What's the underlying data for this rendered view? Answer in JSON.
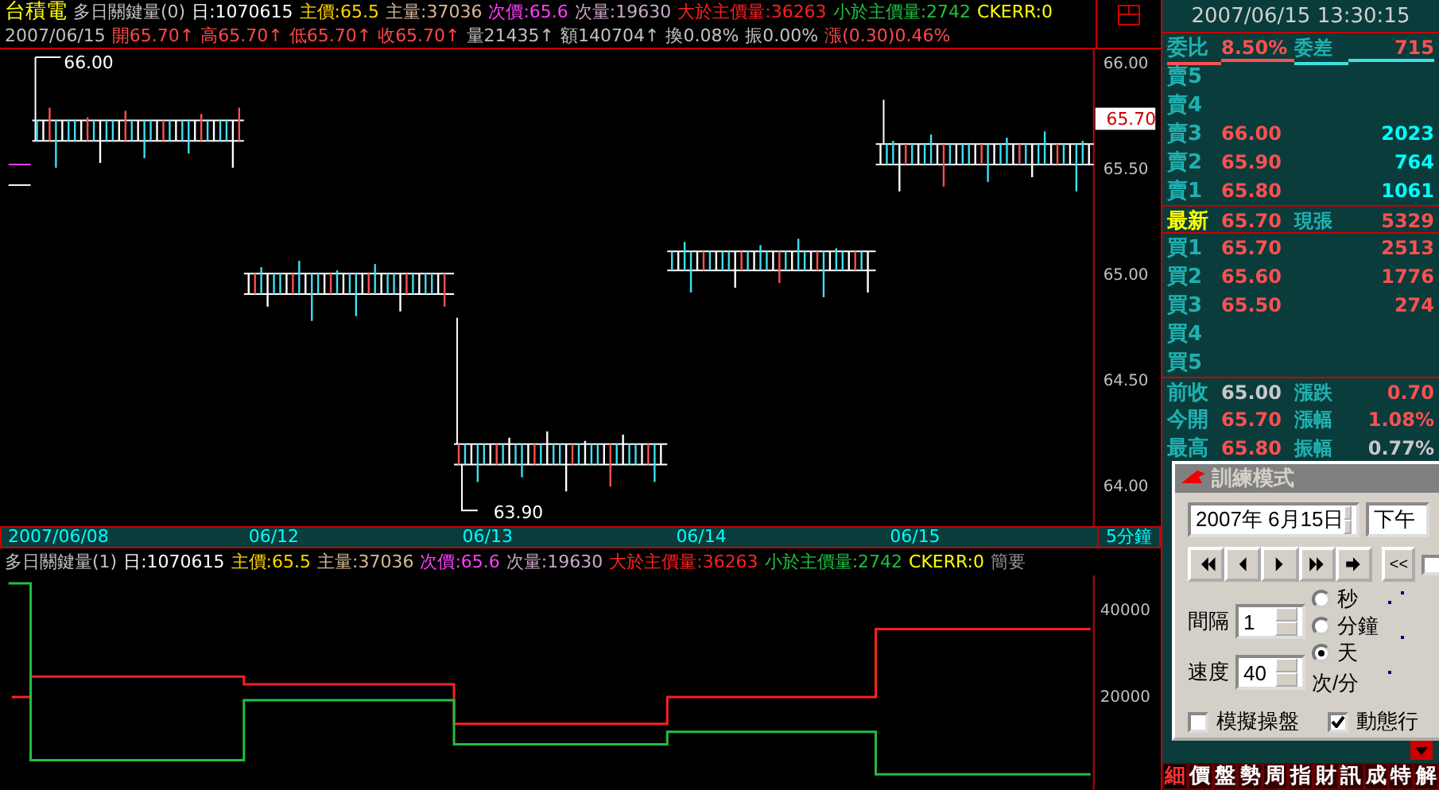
{
  "header": {
    "stock": "台積電",
    "indicator": "多日關鍵量(0)",
    "stats": [
      {
        "text": "日:1070615",
        "color": "#ffffff"
      },
      {
        "text": "主價:65.5",
        "color": "#ffd700"
      },
      {
        "text": "主量:37036",
        "color": "#d8b898"
      },
      {
        "text": "次價:65.6",
        "color": "#ff40ff"
      },
      {
        "text": "次量:19630",
        "color": "#c8a8c8"
      },
      {
        "text": "大於主價量:36263",
        "color": "#ff2020"
      },
      {
        "text": "小於主價量:2742",
        "color": "#20c040"
      },
      {
        "text": "CKERR:0",
        "color": "#ffff00"
      }
    ]
  },
  "quote_line": {
    "date": "2007/06/15",
    "items": [
      {
        "text": "開65.70↑",
        "color": "#ff4848"
      },
      {
        "text": "高65.70↑",
        "color": "#ff4848"
      },
      {
        "text": "低65.70↑",
        "color": "#ff4848"
      },
      {
        "text": "收65.70↑",
        "color": "#ff4848"
      },
      {
        "text": "量21435↑",
        "color": "#c0c0c0"
      },
      {
        "text": "額140704↑",
        "color": "#c0c0c0"
      },
      {
        "text": "換0.08%",
        "color": "#c0c0c0"
      },
      {
        "text": "振0.00%",
        "color": "#c0c0c0"
      },
      {
        "text": "漲(0.30)0.46%",
        "color": "#ff4848"
      }
    ]
  },
  "price_chart": {
    "y_labels": [
      "66.00",
      "65.50",
      "65.00",
      "64.50",
      "64.00"
    ],
    "high_label": "66.00",
    "low_label": "63.90",
    "last_price": "65.70"
  },
  "date_axis": {
    "labels": [
      "2007/06/08",
      "06/12",
      "06/13",
      "06/14",
      "06/15"
    ],
    "period": "5分鐘"
  },
  "volume_chart": {
    "indicator": "多日關鍵量(1)",
    "stats": [
      {
        "text": "日:1070615",
        "color": "#ffffff"
      },
      {
        "text": "主價:65.5",
        "color": "#ffd700"
      },
      {
        "text": "主量:37036",
        "color": "#d8b898"
      },
      {
        "text": "次價:65.6",
        "color": "#ff40ff"
      },
      {
        "text": "次量:19630",
        "color": "#c8a8c8"
      },
      {
        "text": "大於主價量:36263",
        "color": "#ff2020"
      },
      {
        "text": "小於主價量:2742",
        "color": "#20c040"
      },
      {
        "text": "CKERR:0",
        "color": "#ffff00"
      }
    ],
    "summary": "簡要",
    "y_labels": [
      "40000",
      "20000"
    ]
  },
  "quote_panel": {
    "time": "2007/06/15 13:30:15",
    "rows": [
      {
        "kind": "ratio",
        "cells": [
          {
            "text": "委比",
            "color": "#20b0b0"
          },
          {
            "text": "8.50%",
            "color": "#ff5050"
          },
          {
            "text": "委差",
            "color": "#20b0b0"
          },
          {
            "text": "715",
            "color": "#ff5050"
          }
        ]
      },
      {
        "kind": "level",
        "cells": [
          {
            "text": "賣5",
            "color": "#20b0b0"
          }
        ]
      },
      {
        "kind": "level",
        "cells": [
          {
            "text": "賣4",
            "color": "#20b0b0"
          }
        ]
      },
      {
        "kind": "level",
        "cells": [
          {
            "text": "賣3",
            "color": "#20b0b0"
          },
          {
            "text": "66.00",
            "color": "#ff5050"
          },
          {
            "text": "2023",
            "color": "#00ffff"
          }
        ]
      },
      {
        "kind": "level",
        "cells": [
          {
            "text": "賣2",
            "color": "#20b0b0"
          },
          {
            "text": "65.90",
            "color": "#ff5050"
          },
          {
            "text": "764",
            "color": "#00ffff"
          }
        ]
      },
      {
        "kind": "level",
        "cells": [
          {
            "text": "賣1",
            "color": "#20b0b0"
          },
          {
            "text": "65.80",
            "color": "#ff5050"
          },
          {
            "text": "1061",
            "color": "#00ffff"
          }
        ]
      },
      {
        "kind": "last",
        "cells": [
          {
            "text": "最新",
            "color": "#ffff00"
          },
          {
            "text": "65.70",
            "color": "#ff5050"
          },
          {
            "text": "現張",
            "color": "#20b0b0"
          },
          {
            "text": "5329",
            "color": "#ff5050"
          }
        ]
      },
      {
        "kind": "level",
        "cells": [
          {
            "text": "買1",
            "color": "#20b0b0"
          },
          {
            "text": "65.70",
            "color": "#ff5050"
          },
          {
            "text": "2513",
            "color": "#ff5050"
          }
        ]
      },
      {
        "kind": "level",
        "cells": [
          {
            "text": "買2",
            "color": "#20b0b0"
          },
          {
            "text": "65.60",
            "color": "#ff5050"
          },
          {
            "text": "1776",
            "color": "#ff5050"
          }
        ]
      },
      {
        "kind": "level",
        "cells": [
          {
            "text": "買3",
            "color": "#20b0b0"
          },
          {
            "text": "65.50",
            "color": "#ff5050"
          },
          {
            "text": "274",
            "color": "#ff5050"
          }
        ]
      },
      {
        "kind": "level",
        "cells": [
          {
            "text": "買4",
            "color": "#20b0b0"
          }
        ]
      },
      {
        "kind": "level",
        "cells": [
          {
            "text": "買5",
            "color": "#20b0b0"
          }
        ]
      },
      {
        "kind": "stat",
        "cells": [
          {
            "text": "前收",
            "color": "#20b0b0"
          },
          {
            "text": "65.00",
            "color": "#c8c8c8"
          },
          {
            "text": "漲跌",
            "color": "#20b0b0"
          },
          {
            "text": "0.70",
            "color": "#ff5050"
          }
        ]
      },
      {
        "kind": "stat",
        "cells": [
          {
            "text": "今開",
            "color": "#20b0b0"
          },
          {
            "text": "65.70",
            "color": "#ff5050"
          },
          {
            "text": "漲幅",
            "color": "#20b0b0"
          },
          {
            "text": "1.08%",
            "color": "#ff5050"
          }
        ]
      },
      {
        "kind": "stat",
        "cells": [
          {
            "text": "最高",
            "color": "#20b0b0"
          },
          {
            "text": "65.80",
            "color": "#ff5050"
          },
          {
            "text": "振幅",
            "color": "#20b0b0"
          },
          {
            "text": "0.77%",
            "color": "#c8c8c8"
          }
        ]
      }
    ]
  },
  "training_dialog": {
    "title": "訓練模式",
    "date_value": "2007年 6月15日",
    "period_value": "下午",
    "back_button": "<<",
    "side_checkbox": {
      "checked": false
    },
    "interval_label": "間隔",
    "interval_value": "1",
    "speed_label": "速度",
    "speed_value": "40",
    "units": [
      {
        "label": "秒",
        "selected": false
      },
      {
        "label": "分鐘",
        "selected": false
      },
      {
        "label": "天",
        "selected": true
      }
    ],
    "rate_unit": "次/分",
    "checkboxes": [
      {
        "label": "模擬操盤",
        "checked": false
      },
      {
        "label": "動態行",
        "checked": true
      }
    ]
  },
  "bottom_tabs": [
    {
      "label": "細",
      "selected": true
    },
    {
      "label": "價",
      "selected": false
    },
    {
      "label": "盤",
      "selected": false
    },
    {
      "label": "勢",
      "selected": false
    },
    {
      "label": "周",
      "selected": false
    },
    {
      "label": "指",
      "selected": false
    },
    {
      "label": "財",
      "selected": false
    },
    {
      "label": "訊",
      "selected": false
    },
    {
      "label": "成",
      "selected": false
    },
    {
      "label": "特",
      "selected": false
    },
    {
      "label": "解",
      "selected": false
    }
  ]
}
